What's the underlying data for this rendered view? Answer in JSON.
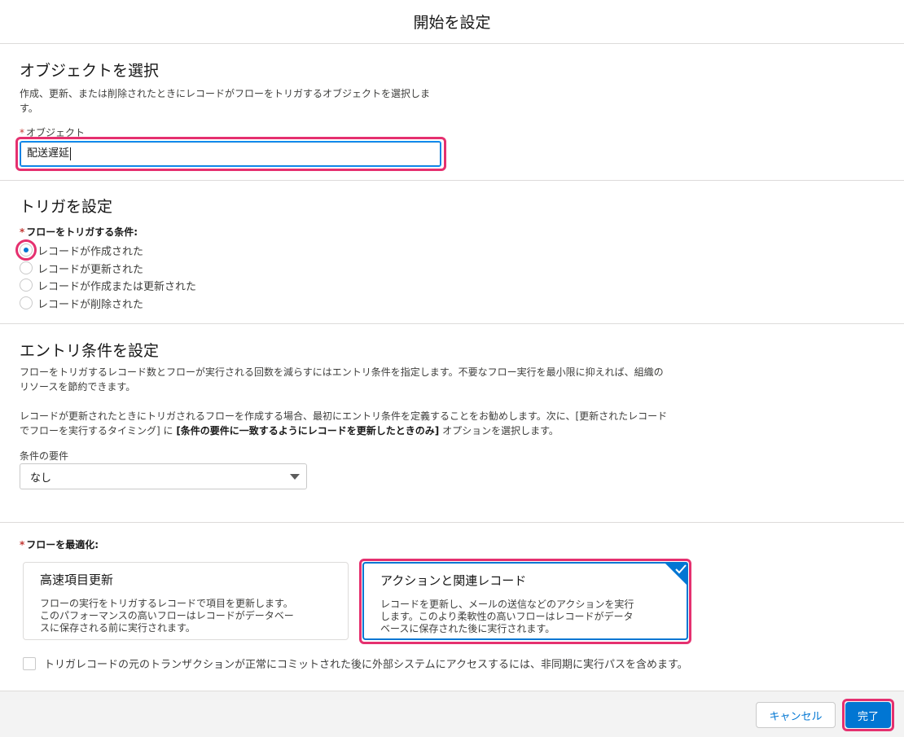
{
  "header": {
    "title": "開始を設定"
  },
  "object_section": {
    "title": "オブジェクトを選択",
    "description_line1": "作成、更新、または削除されたときにレコードがフローをトリガするオブジェクトを選択しま",
    "description_line2": "す。",
    "field_required": "*",
    "field_label": "オブジェクト",
    "field_value": "配送遅延"
  },
  "trigger_section": {
    "title": "トリガを設定",
    "field_required": "*",
    "field_label": "フローをトリガする条件:",
    "options": [
      {
        "label": "レコードが作成された",
        "checked": true
      },
      {
        "label": "レコードが更新された",
        "checked": false
      },
      {
        "label": "レコードが作成または更新された",
        "checked": false
      },
      {
        "label": "レコードが削除された",
        "checked": false
      }
    ]
  },
  "entry_section": {
    "title": "エントリ条件を設定",
    "para1_line1": "フローをトリガするレコード数とフローが実行される回数を減らすにはエントリ条件を指定します。不要なフロー実行を最小限に抑えれば、組織の",
    "para1_line2": "リソースを節約できます。",
    "para2_line1": "レコードが更新されたときにトリガされるフローを作成する場合、最初にエントリ条件を定義することをお勧めします。次に、[更新されたレコード",
    "para2_line2_a": "でフローを実行するタイミング] に ",
    "para2_line2_bold": "[条件の要件に一致するようにレコードを更新したときのみ]",
    "para2_line2_b": " オプションを選択します。",
    "select_label": "条件の要件",
    "select_value": "なし"
  },
  "optimize_section": {
    "field_required": "*",
    "field_label": "フローを最適化:",
    "cards": [
      {
        "title": "高速項目更新",
        "desc_line1": "フローの実行をトリガするレコードで項目を更新します。",
        "desc_line2": "このパフォーマンスの高いフローはレコードがデータベー",
        "desc_line3": "スに保存される前に実行されます。",
        "selected": false
      },
      {
        "title": "アクションと関連レコード",
        "desc_line1": "レコードを更新し、メールの送信などのアクションを実行",
        "desc_line2": "します。このより柔軟性の高いフローはレコードがデータ",
        "desc_line3": "ベースに保存された後に実行されます。",
        "selected": true
      }
    ],
    "async_checkbox_label": "トリガレコードの元のトランザクションが正常にコミットされた後に外部システムにアクセスするには、非同期に実行パスを含めます。"
  },
  "footer": {
    "cancel_label": "キャンセル",
    "done_label": "完了"
  },
  "colors": {
    "brand": "#0176d3",
    "highlight": "#e5306f",
    "required": "#c23934"
  }
}
